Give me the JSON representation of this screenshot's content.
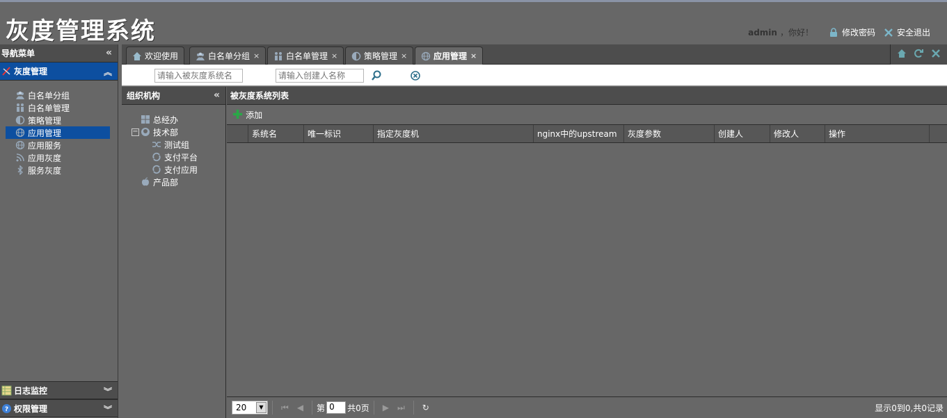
{
  "app": {
    "title": "灰度管理系统"
  },
  "user": {
    "name": "admin",
    "greeting": "，你好！",
    "change_password": "修改密码",
    "logout": "安全退出"
  },
  "nav": {
    "title": "导航菜单",
    "sections": [
      {
        "label": "灰度管理",
        "icon": "gray-manage-icon"
      },
      {
        "label": "日志监控",
        "icon": "log-monitor-icon"
      },
      {
        "label": "权限管理",
        "icon": "permission-icon"
      }
    ],
    "items": [
      {
        "label": "白名单分组",
        "icon": "group-icon"
      },
      {
        "label": "白名单管理",
        "icon": "users-icon"
      },
      {
        "label": "策略管理",
        "icon": "half-circle-icon"
      },
      {
        "label": "应用管理",
        "icon": "globe-icon"
      },
      {
        "label": "应用服务",
        "icon": "globe-icon"
      },
      {
        "label": "应用灰度",
        "icon": "rss-icon"
      },
      {
        "label": "服务灰度",
        "icon": "bluetooth-icon"
      }
    ]
  },
  "tabs": [
    {
      "label": "欢迎使用",
      "icon": "home-icon",
      "closable": false
    },
    {
      "label": "白名单分组",
      "icon": "group-icon",
      "closable": true
    },
    {
      "label": "白名单管理",
      "icon": "users-icon",
      "closable": true
    },
    {
      "label": "策略管理",
      "icon": "half-circle-icon",
      "closable": true
    },
    {
      "label": "应用管理",
      "icon": "globe-icon",
      "closable": true,
      "active": true
    }
  ],
  "tab_close_glyph": "×",
  "search": {
    "system_placeholder": "请输入被灰度系统名",
    "creator_placeholder": "请输入创建人名称"
  },
  "org": {
    "title": "组织机构",
    "nodes": [
      {
        "label": "总经办",
        "icon": "windows-icon"
      },
      {
        "label": "技术部",
        "icon": "github-icon"
      },
      {
        "label": "测试组",
        "icon": "shuffle-icon"
      },
      {
        "label": "支付平台",
        "icon": "sync-icon"
      },
      {
        "label": "支付应用",
        "icon": "sync-icon"
      },
      {
        "label": "产品部",
        "icon": "apple-icon"
      }
    ]
  },
  "list": {
    "title": "被灰度系统列表",
    "add_label": "添加",
    "columns": [
      "系统名",
      "唯一标识",
      "指定灰度机",
      "nginx中的upstream",
      "灰度参数",
      "创建人",
      "修改人",
      "操作"
    ]
  },
  "pager": {
    "page_size": "20",
    "page_prefix": "第",
    "page_value": "0",
    "page_suffix": "共0页",
    "info": "显示0到0,共0记录"
  }
}
